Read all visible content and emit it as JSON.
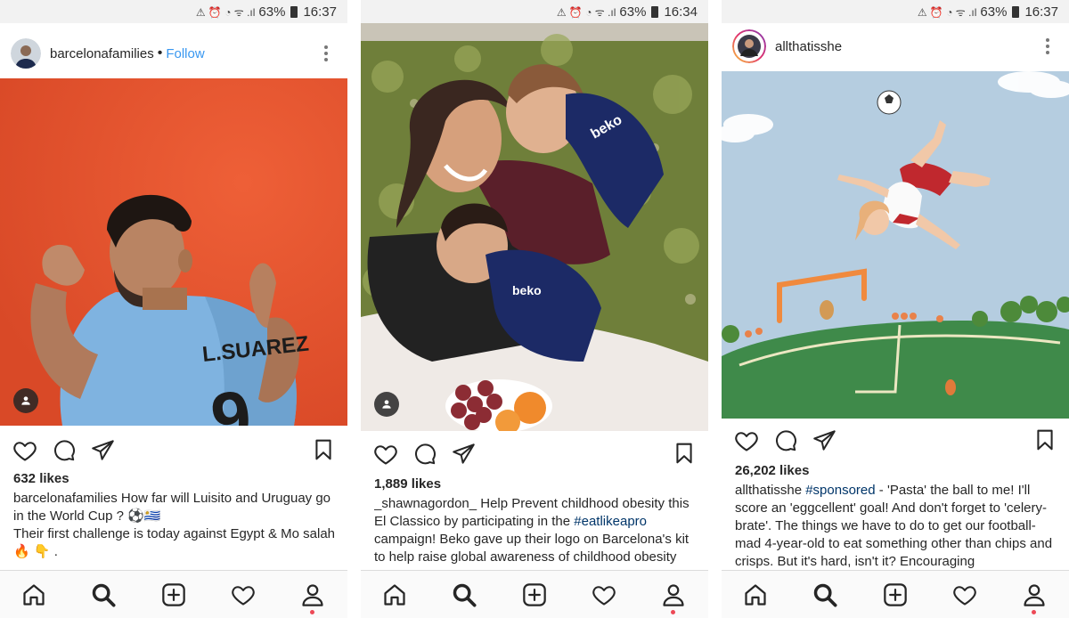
{
  "status_bars": [
    {
      "battery": "63%",
      "time": "16:37"
    },
    {
      "battery": "63%",
      "time": "16:34"
    },
    {
      "battery": "63%",
      "time": "16:37"
    }
  ],
  "posts": [
    {
      "username": "barcelonafamilies",
      "follow_label": "Follow",
      "likes": "632 likes",
      "caption_user": "barcelonafamilies",
      "caption_text": " How far will Luisito and Uruguay go in the World Cup ? ⚽🇺🇾",
      "caption_line2": "Their first challenge is today against Egypt & Mo salah 🔥 👇 .",
      "photo_shirt_name": "L.SUAREZ",
      "photo_shirt_number": "9"
    },
    {
      "username": "_shawnagordon_",
      "likes": "1,889 likes",
      "caption_user": "_shawnagordon_",
      "caption_text_1": " Help Prevent childhood obesity this El Classico by participating in the ",
      "caption_hashtag": "#eatlikeapro",
      "caption_text_2": " campaign! Beko gave up their logo on Barcelona's kit to help raise global awareness of childhood obesity",
      "photo_logo": "beko"
    },
    {
      "username": "allthatisshe",
      "likes": "26,202 likes",
      "caption_user": "allthatisshe",
      "caption_hashtag": "#sponsored",
      "caption_text": " - 'Pasta' the ball to me! I'll score an 'eggcellent' goal! And don't forget to 'celery-brate'. The things we have to do to get our football-mad 4-year-old to eat something other than chips and crisps. But it's hard, isn't it? Encouraging"
    }
  ],
  "nav_icons": [
    "home-icon",
    "search-icon",
    "new-post-icon",
    "activity-icon",
    "profile-icon"
  ],
  "colors": {
    "link": "#3897f0",
    "hashtag": "#003569",
    "notification": "#ed4956"
  }
}
